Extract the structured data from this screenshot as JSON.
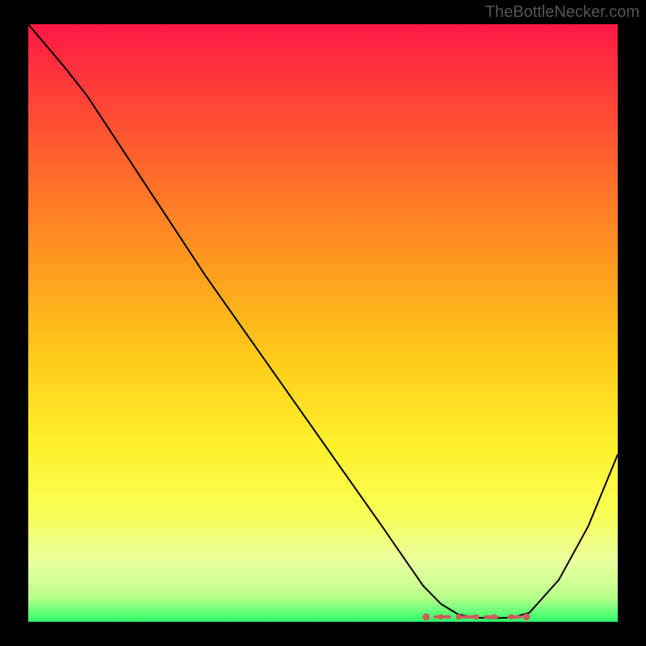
{
  "watermark": "TheBottleNecker.com",
  "chart_data": {
    "type": "line",
    "title": "",
    "xlabel": "",
    "ylabel": "",
    "xlim": [
      0,
      100
    ],
    "ylim": [
      0,
      100
    ],
    "series": [
      {
        "name": "curve",
        "x": [
          0,
          6,
          10,
          20,
          30,
          40,
          50,
          60,
          67,
          70,
          73,
          76,
          79,
          82,
          85,
          90,
          95,
          100
        ],
        "y": [
          100,
          93,
          88,
          73,
          58,
          44,
          30,
          16,
          6,
          3,
          1.2,
          0.7,
          0.6,
          0.7,
          1.5,
          7,
          16,
          28
        ],
        "color": "#000000",
        "width": 2
      }
    ],
    "bottom_markers": {
      "color": "#cd5c5c",
      "type": "scatter-with-dashes",
      "points_x": [
        67.5,
        70,
        73,
        76,
        79,
        82,
        84.5
      ],
      "points_y_relative": 0.5,
      "dash_segments": [
        [
          69,
          71.5
        ],
        [
          73.5,
          75.5
        ],
        [
          77.5,
          79.5
        ],
        [
          81.5,
          83.5
        ]
      ]
    },
    "background_gradient": {
      "stops": [
        {
          "offset": 0.0,
          "color": "#ff1744"
        },
        {
          "offset": 0.1,
          "color": "#ff3a3a"
        },
        {
          "offset": 0.25,
          "color": "#ff6a2a"
        },
        {
          "offset": 0.4,
          "color": "#ff9a1f"
        },
        {
          "offset": 0.55,
          "color": "#ffc81a"
        },
        {
          "offset": 0.7,
          "color": "#fff02a"
        },
        {
          "offset": 0.82,
          "color": "#f8ff55"
        },
        {
          "offset": 0.9,
          "color": "#eaffa0"
        },
        {
          "offset": 0.96,
          "color": "#b8ff8a"
        },
        {
          "offset": 1.0,
          "color": "#2aff6a"
        }
      ]
    }
  }
}
